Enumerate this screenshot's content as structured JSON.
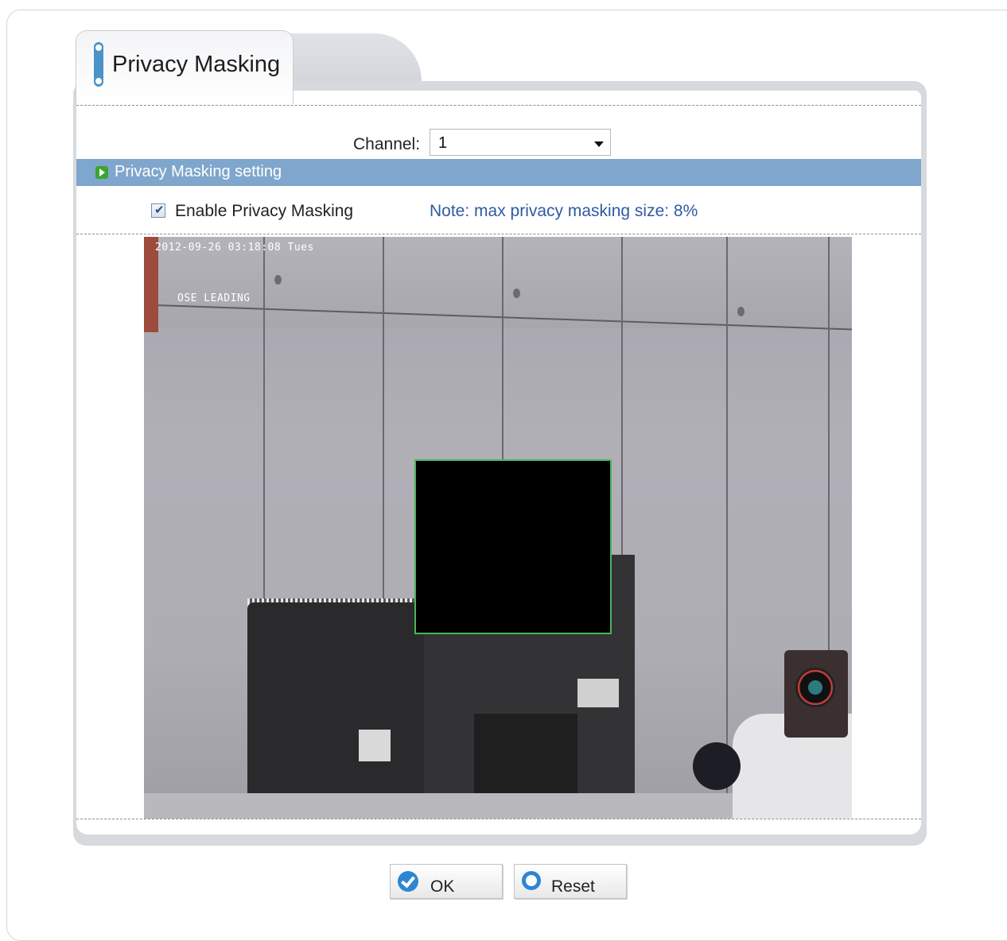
{
  "tab": {
    "title": "Privacy Masking"
  },
  "channel": {
    "label": "Channel:",
    "value": "1"
  },
  "section": {
    "title": "Privacy Masking setting"
  },
  "enable": {
    "label": "Enable Privacy Masking",
    "checked": true
  },
  "note": "Note: max privacy masking size: 8%",
  "camera": {
    "osd_timestamp": "2012-09-26 03:18:08 Tues",
    "osd_title": "OSE LEADING",
    "mask_color": "#000000",
    "mask_border_color": "#48b65a"
  },
  "buttons": {
    "ok_label": "OK",
    "reset_label": "Reset"
  },
  "colors": {
    "section_bar": "#7fa6cc",
    "note_text": "#2e5b9f",
    "accent": "#2e86d3"
  }
}
